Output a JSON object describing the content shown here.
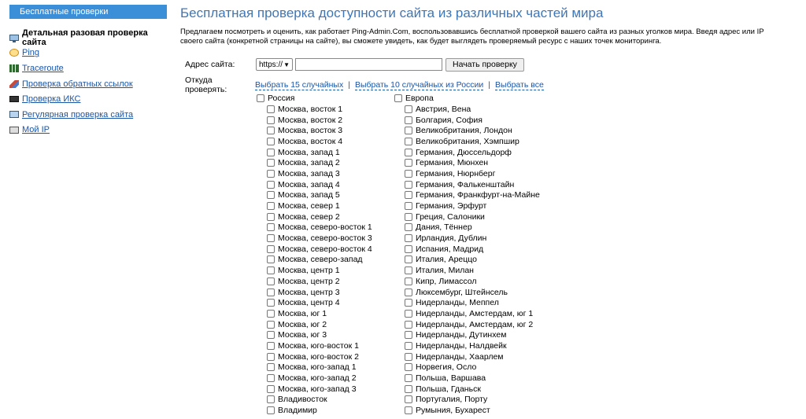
{
  "sidebar": {
    "header": "Бесплатные проверки",
    "items": [
      {
        "label": "Детальная разовая проверка сайта",
        "active": true
      },
      {
        "label": "Ping"
      },
      {
        "label": "Traceroute"
      },
      {
        "label": "Проверка обратных ссылок"
      },
      {
        "label": "Проверка ИКС"
      },
      {
        "label": "Регулярная проверка сайта"
      },
      {
        "label": "Мой IP"
      }
    ]
  },
  "main": {
    "title": "Бесплатная проверка доступности сайта из различных частей мира",
    "intro": "Предлагаем посмотреть и оценить, как работает Ping-Admin.Com, воспользовавшись бесплатной проверкой вашего сайта из разных уголков мира. Введя адрес или IP своего сайта (конкретной страницы на сайте), вы сможете увидеть, как будет выглядеть проверяемый ресурс с наших точек мониторинга.",
    "address_label": "Адрес сайта:",
    "protocol_value": "https://",
    "url_value": "",
    "start_button": "Начать проверку",
    "from_label": "Откуда проверять:",
    "select_15": "Выбрать 15 случайных",
    "select_10_ru": "Выбрать 10 случайных из России",
    "select_all": "Выбрать все",
    "separator": "|"
  },
  "russia": {
    "group_label": "Россия",
    "locations": [
      "Москва, восток 1",
      "Москва, восток 2",
      "Москва, восток 3",
      "Москва, восток 4",
      "Москва, запад 1",
      "Москва, запад 2",
      "Москва, запад 3",
      "Москва, запад 4",
      "Москва, запад 5",
      "Москва, север 1",
      "Москва, север 2",
      "Москва, северо-восток 1",
      "Москва, северо-восток 3",
      "Москва, северо-восток 4",
      "Москва, северо-запад",
      "Москва, центр 1",
      "Москва, центр 2",
      "Москва, центр 3",
      "Москва, центр 4",
      "Москва, юг 1",
      "Москва, юг 2",
      "Москва, юг 3",
      "Москва, юго-восток 1",
      "Москва, юго-восток 2",
      "Москва, юго-запад 1",
      "Москва, юго-запад 2",
      "Москва, юго-запад 3",
      "Владивосток",
      "Владимир"
    ]
  },
  "europe": {
    "group_label": "Европа",
    "locations": [
      "Австрия, Вена",
      "Болгария, София",
      "Великобритания, Лондон",
      "Великобритания, Хэмпшир",
      "Германия, Дюссельдорф",
      "Германия, Мюнхен",
      "Германия, Нюрнберг",
      "Германия, Фалькенштайн",
      "Германия, Франкфурт-на-Майне",
      "Германия, Эрфурт",
      "Греция, Салоники",
      "Дания, Тённер",
      "Ирландия, Дублин",
      "Испания, Мадрид",
      "Италия, Ареццо",
      "Италия, Милан",
      "Кипр, Лимассол",
      "Люксембург, Штейнсель",
      "Нидерланды, Меппел",
      "Нидерланды, Амстердам, юг 1",
      "Нидерланды, Амстердам, юг 2",
      "Нидерланды, Дутинхем",
      "Нидерланды, Налдвейк",
      "Нидерланды, Хаарлем",
      "Норвегия, Осло",
      "Польша, Варшава",
      "Польша, Гданьск",
      "Португалия, Порту",
      "Румыния, Бухарест"
    ]
  },
  "colors": {
    "accent": "#3a8fd8",
    "title": "#3f76b6",
    "link": "#1a55a8"
  }
}
